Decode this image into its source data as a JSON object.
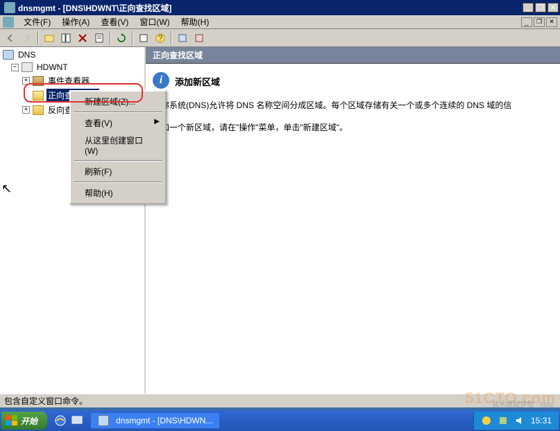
{
  "titlebar": {
    "title": "dnsmgmt - [DNS\\HDWNT\\正向查找区域]",
    "min": "_",
    "restore": "❐",
    "close": "✕"
  },
  "menubar": {
    "file": "文件(F)",
    "action": "操作(A)",
    "view": "查看(V)",
    "window": "窗口(W)",
    "help": "帮助(H)"
  },
  "tree": {
    "root": "DNS",
    "server": "HDWNT",
    "eventviewer": "事件查看器",
    "forward": "正向查找区域",
    "reverse": "反向查找区域"
  },
  "contextmenu": {
    "newzone": "新建区域(Z)...",
    "view": "查看(V)",
    "newwindow": "从这里创建窗口(W)",
    "refresh": "刷新(F)",
    "help": "帮助(H)"
  },
  "content": {
    "header": "正向查找区域",
    "title": "添加新区域",
    "desc1_partial": "名称系统(DNS)允许将 DNS 名称空间分成区域。每个区域存储有关一个或多个连续的 DNS 域的信",
    "desc2": "添加一个新区域，请在\"操作\"菜单，单击\"新建区域\"。"
  },
  "statusbar": {
    "text": "包含自定义窗口命令。"
  },
  "taskbar": {
    "start": "开始",
    "task1": "dnsmgmt - [DNS\\HDWN...",
    "time": "15:31"
  },
  "watermark": {
    "main": "51CTO.com",
    "sub": "技术成就梦想 · blog"
  }
}
